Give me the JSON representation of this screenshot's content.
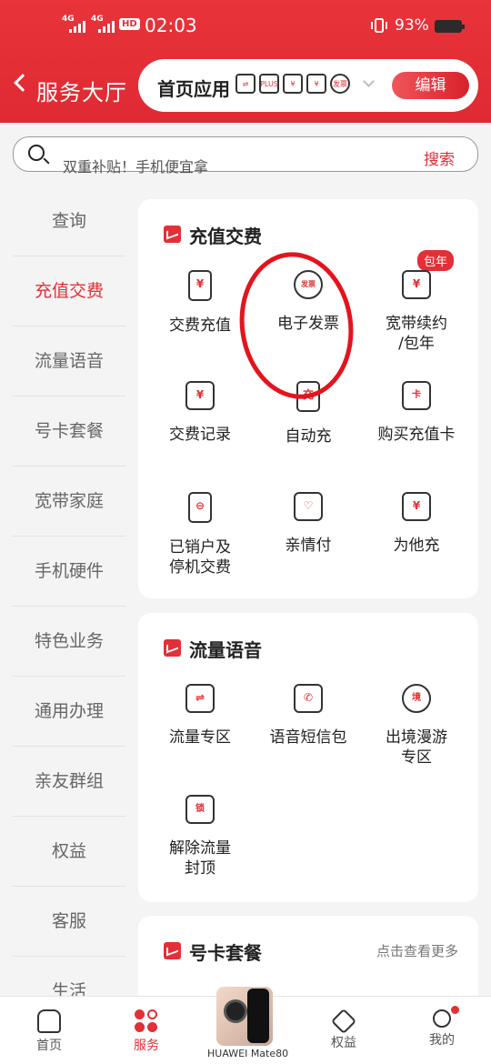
{
  "status_bar": {
    "net1": "4G",
    "net2": "4G",
    "hd": "HD",
    "time": "02:03",
    "battery": "93%"
  },
  "header": {
    "title": "服务大厅",
    "home_apps_label": "首页应用",
    "edit": "编辑",
    "mini_icons": [
      "⇌",
      "PLUS",
      "¥",
      "¥",
      "发票"
    ]
  },
  "search": {
    "placeholder": "双重补贴！手机便宜拿",
    "button": "搜索"
  },
  "sidebar": {
    "items": [
      {
        "label": "查询"
      },
      {
        "label": "充值交费"
      },
      {
        "label": "流量语音"
      },
      {
        "label": "号卡套餐"
      },
      {
        "label": "宽带家庭"
      },
      {
        "label": "手机硬件"
      },
      {
        "label": "特色业务"
      },
      {
        "label": "通用办理"
      },
      {
        "label": "亲友群组"
      },
      {
        "label": "权益"
      },
      {
        "label": "客服"
      },
      {
        "label": "生活"
      }
    ]
  },
  "section_recharge": {
    "title": "充值交费",
    "badge": "包年",
    "items": [
      {
        "label": "交费充值",
        "icon": "¥"
      },
      {
        "label": "电子发票",
        "icon": "发票"
      },
      {
        "label": "宽带续约\n/包年",
        "icon": "¥"
      },
      {
        "label": "交费记录",
        "icon": "¥"
      },
      {
        "label": "自动充",
        "icon": "充"
      },
      {
        "label": "购买充值卡",
        "icon": "卡"
      },
      {
        "label": "已销户及\n停机交费",
        "icon": "⊖"
      },
      {
        "label": "亲情付",
        "icon": "♡"
      },
      {
        "label": "为他充",
        "icon": "¥"
      }
    ]
  },
  "section_traffic": {
    "title": "流量语音",
    "items": [
      {
        "label": "流量专区",
        "icon": "⇌"
      },
      {
        "label": "语音短信包",
        "icon": "✆"
      },
      {
        "label": "出境漫游\n专区",
        "icon": "境"
      },
      {
        "label": "解除流量\n封顶",
        "icon": "锁"
      }
    ]
  },
  "section_numbercard": {
    "title": "号卡套餐",
    "more": "点击查看更多"
  },
  "bottom_nav": {
    "items": [
      {
        "label": "首页"
      },
      {
        "label": "服务"
      },
      {
        "label": "权益"
      },
      {
        "label": "我的"
      }
    ]
  },
  "watermark": "HUAWEI Mate80",
  "colors": {
    "brand_red": "#e32f36",
    "sidebar_active": "#e32f36"
  }
}
